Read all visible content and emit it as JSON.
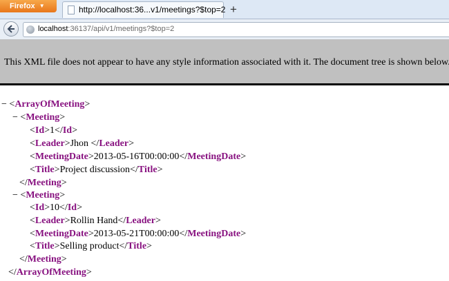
{
  "browser": {
    "app_button": "Firefox",
    "tab_title": "http://localhost:36...v1/meetings?$top=2",
    "new_tab_label": "+",
    "url_host": "localhost",
    "url_rest": ":36137/api/v1/meetings?$top=2"
  },
  "infobar": {
    "message": "This XML file does not appear to have any style information associated with it. The document tree is shown below."
  },
  "xml": {
    "toggle": "−",
    "root_tag": "ArrayOfMeeting",
    "meeting_tag": "Meeting",
    "field_tags": {
      "id": "Id",
      "leader": "Leader",
      "date": "MeetingDate",
      "title": "Title"
    },
    "meetings": [
      {
        "id": "1",
        "leader": "Jhon ",
        "date": "2013-05-16T00:00:00",
        "title": "Project discussion"
      },
      {
        "id": "10",
        "leader": "Rollin Hand",
        "date": "2013-05-21T00:00:00",
        "title": "Selling product"
      }
    ]
  }
}
